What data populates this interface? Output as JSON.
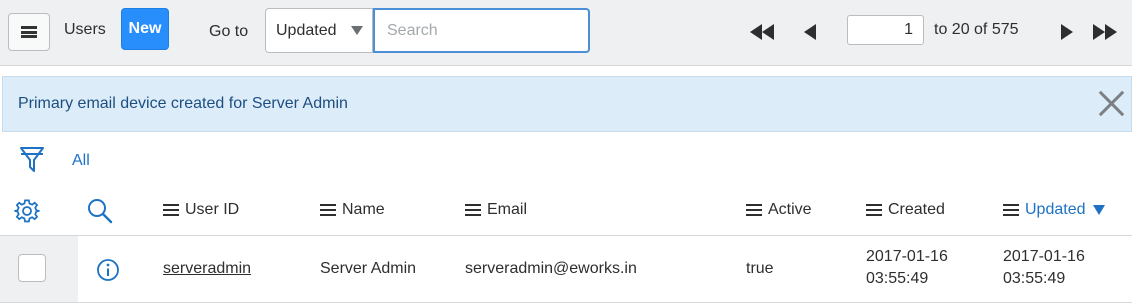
{
  "toolbar": {
    "title": "Users",
    "new_label": "New",
    "goto_label": "Go to",
    "select_value": "Updated",
    "search_placeholder": "Search",
    "page_value": "1",
    "range_text": "to 20 of 575"
  },
  "alert": {
    "message": "Primary email device created for Server Admin"
  },
  "filter": {
    "label": "All"
  },
  "columns": {
    "user_id": "User ID",
    "name": "Name",
    "email": "Email",
    "active": "Active",
    "created": "Created",
    "updated": "Updated"
  },
  "rows": [
    {
      "user_id": "serveradmin",
      "name": "Server Admin",
      "email": "serveradmin@eworks.in",
      "active": "true",
      "created_date": "2017-01-16",
      "created_time": "03:55:49",
      "updated_date": "2017-01-16",
      "updated_time": "03:55:49"
    }
  ],
  "colors": {
    "accent": "#278efc",
    "link": "#1d72c4",
    "alert_bg": "#dcecf8",
    "toolbar_bg": "#eef0f1"
  },
  "icons": {
    "menu": "hamburger-icon",
    "first": "first-page-icon",
    "prev": "previous-page-icon",
    "next": "next-page-icon",
    "last": "last-page-icon",
    "close": "close-icon",
    "filter": "filter-icon",
    "gear": "gear-icon",
    "search": "search-icon",
    "info": "info-icon"
  }
}
